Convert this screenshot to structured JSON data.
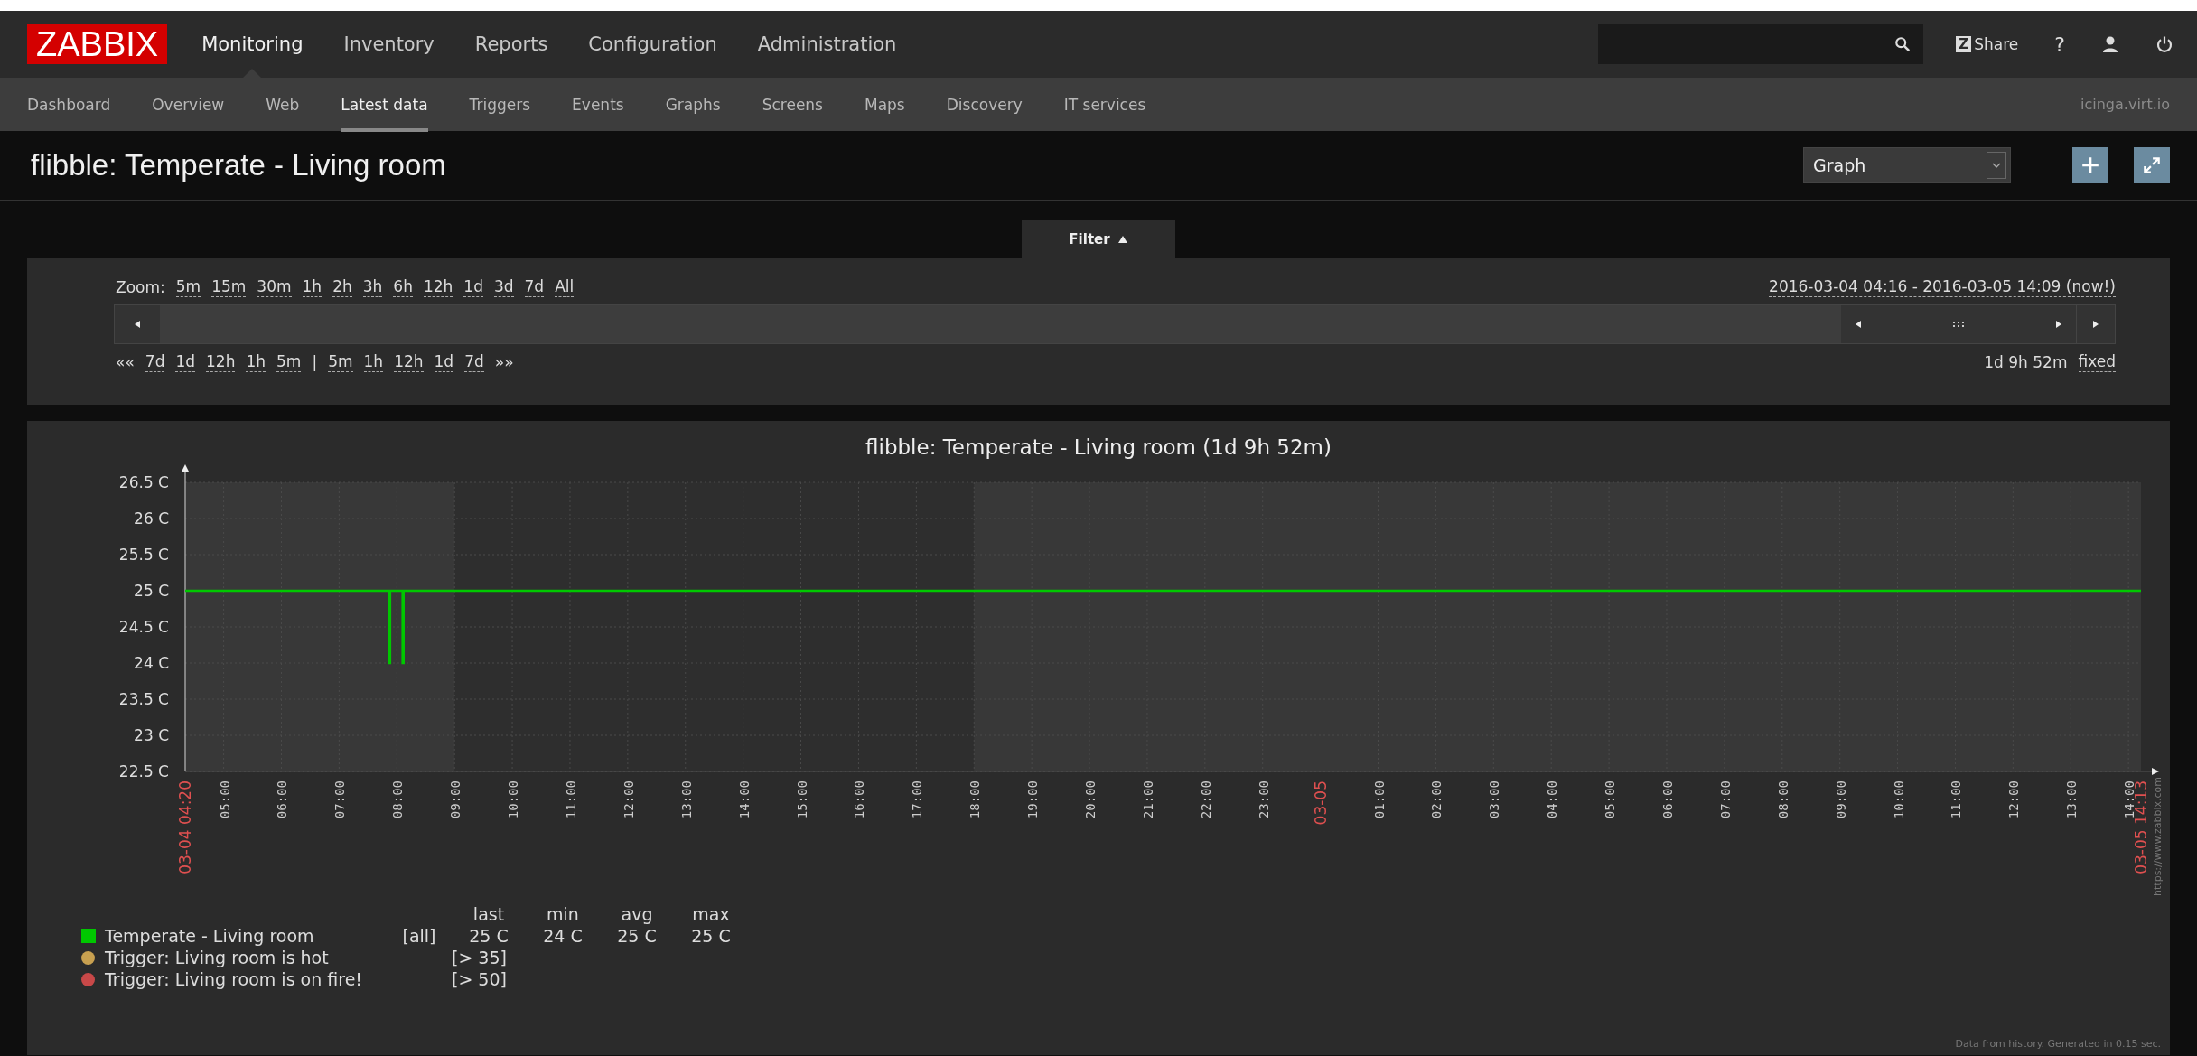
{
  "header": {
    "logo": "ZABBIX",
    "menu": [
      {
        "label": "Monitoring",
        "selected": true
      },
      {
        "label": "Inventory",
        "selected": false
      },
      {
        "label": "Reports",
        "selected": false
      },
      {
        "label": "Configuration",
        "selected": false
      },
      {
        "label": "Administration",
        "selected": false
      }
    ],
    "share_badge": "Z",
    "share": "Share",
    "help": "?"
  },
  "submenu": {
    "items": [
      {
        "label": "Dashboard",
        "selected": false
      },
      {
        "label": "Overview",
        "selected": false
      },
      {
        "label": "Web",
        "selected": false
      },
      {
        "label": "Latest data",
        "selected": true
      },
      {
        "label": "Triggers",
        "selected": false
      },
      {
        "label": "Events",
        "selected": false
      },
      {
        "label": "Graphs",
        "selected": false
      },
      {
        "label": "Screens",
        "selected": false
      },
      {
        "label": "Maps",
        "selected": false
      },
      {
        "label": "Discovery",
        "selected": false
      },
      {
        "label": "IT services",
        "selected": false
      }
    ],
    "server": "icinga.virt.io"
  },
  "page": {
    "title": "flibble: Temperate - Living room",
    "view_select": "Graph"
  },
  "filter": {
    "tab": "Filter",
    "expanded": true,
    "zoom_label": "Zoom:",
    "zoom_links": [
      "5m",
      "15m",
      "30m",
      "1h",
      "2h",
      "3h",
      "6h",
      "12h",
      "1d",
      "3d",
      "7d",
      "All"
    ],
    "range": "2016-03-04 04:16 - 2016-03-05 14:09 (now!)",
    "shift_links": [
      {
        "label": "««",
        "kind": "arrow"
      },
      {
        "label": "7d",
        "kind": "period"
      },
      {
        "label": "1d",
        "kind": "period"
      },
      {
        "label": "12h",
        "kind": "period"
      },
      {
        "label": "1h",
        "kind": "period"
      },
      {
        "label": "5m",
        "kind": "period"
      },
      {
        "label": "|",
        "kind": "separator"
      },
      {
        "label": "5m",
        "kind": "period"
      },
      {
        "label": "1h",
        "kind": "period"
      },
      {
        "label": "12h",
        "kind": "period"
      },
      {
        "label": "1d",
        "kind": "period"
      },
      {
        "label": "7d",
        "kind": "period"
      },
      {
        "label": "»»",
        "kind": "arrow"
      }
    ],
    "period": "1d 9h 52m",
    "fixed": "fixed"
  },
  "graph": {
    "title": "flibble: Temperate - Living room (1d 9h 52m)",
    "chart_data": {
      "type": "line",
      "grid": true,
      "ylim": [
        22.5,
        26.5
      ],
      "xlim": [
        "2016-03-04 04:20",
        "2016-03-05 14:13"
      ],
      "yticks": [
        {
          "value": 22.5,
          "label": "22.5 C"
        },
        {
          "value": 23,
          "label": "23 C"
        },
        {
          "value": 23.5,
          "label": "23.5 C"
        },
        {
          "value": 24,
          "label": "24 C"
        },
        {
          "value": 24.5,
          "label": "24.5 C"
        },
        {
          "value": 25,
          "label": "25 C"
        },
        {
          "value": 25.5,
          "label": "25.5 C"
        },
        {
          "value": 26,
          "label": "26 C"
        },
        {
          "value": 26.5,
          "label": "26.5 C"
        }
      ],
      "xticks": [
        {
          "value": "2016-03-04 04:20",
          "label": "03-04 04:20"
        },
        {
          "value": "2016-03-04 05:00",
          "label": "05:00"
        },
        {
          "value": "2016-03-04 06:00",
          "label": "06:00"
        },
        {
          "value": "2016-03-04 07:00",
          "label": "07:00"
        },
        {
          "value": "2016-03-04 08:00",
          "label": "08:00"
        },
        {
          "value": "2016-03-04 09:00",
          "label": "09:00"
        },
        {
          "value": "2016-03-04 10:00",
          "label": "10:00"
        },
        {
          "value": "2016-03-04 11:00",
          "label": "11:00"
        },
        {
          "value": "2016-03-04 12:00",
          "label": "12:00"
        },
        {
          "value": "2016-03-04 13:00",
          "label": "13:00"
        },
        {
          "value": "2016-03-04 14:00",
          "label": "14:00"
        },
        {
          "value": "2016-03-04 15:00",
          "label": "15:00"
        },
        {
          "value": "2016-03-04 16:00",
          "label": "16:00"
        },
        {
          "value": "2016-03-04 17:00",
          "label": "17:00"
        },
        {
          "value": "2016-03-04 18:00",
          "label": "18:00"
        },
        {
          "value": "2016-03-04 19:00",
          "label": "19:00"
        },
        {
          "value": "2016-03-04 20:00",
          "label": "20:00"
        },
        {
          "value": "2016-03-04 21:00",
          "label": "21:00"
        },
        {
          "value": "2016-03-04 22:00",
          "label": "22:00"
        },
        {
          "value": "2016-03-04 23:00",
          "label": "23:00"
        },
        {
          "value": "2016-03-05 00:00",
          "label": "03-05"
        },
        {
          "value": "2016-03-05 01:00",
          "label": "01:00"
        },
        {
          "value": "2016-03-05 02:00",
          "label": "02:00"
        },
        {
          "value": "2016-03-05 03:00",
          "label": "03:00"
        },
        {
          "value": "2016-03-05 04:00",
          "label": "04:00"
        },
        {
          "value": "2016-03-05 05:00",
          "label": "05:00"
        },
        {
          "value": "2016-03-05 06:00",
          "label": "06:00"
        },
        {
          "value": "2016-03-05 07:00",
          "label": "07:00"
        },
        {
          "value": "2016-03-05 08:00",
          "label": "08:00"
        },
        {
          "value": "2016-03-05 09:00",
          "label": "09:00"
        },
        {
          "value": "2016-03-05 10:00",
          "label": "10:00"
        },
        {
          "value": "2016-03-05 11:00",
          "label": "11:00"
        },
        {
          "value": "2016-03-05 12:00",
          "label": "12:00"
        },
        {
          "value": "2016-03-05 13:00",
          "label": "13:00"
        },
        {
          "value": "2016-03-05 14:00",
          "label": "14:00"
        },
        {
          "value": "2016-03-05 14:13",
          "label": "03-05 14:13"
        }
      ],
      "x": [
        "2016-03-04 04:20",
        "2016-03-04 07:52",
        "2016-03-04 07:52",
        "2016-03-04 07:53",
        "2016-03-04 07:53",
        "2016-03-04 08:06",
        "2016-03-04 08:06",
        "2016-03-04 08:07",
        "2016-03-04 08:07",
        "2016-03-05 14:13"
      ],
      "series": [
        {
          "name": "Temperate - Living room",
          "color": "#00c800",
          "values": [
            25,
            25,
            24,
            24,
            25,
            25,
            24,
            24,
            25,
            25
          ]
        }
      ]
    },
    "legend": {
      "headers": [
        "last",
        "min",
        "avg",
        "max"
      ],
      "items": [
        {
          "kind": "item",
          "function": "[all]",
          "last": "25 C",
          "min": "24 C",
          "avg": "25 C",
          "max": "25 C"
        },
        {
          "kind": "trigger",
          "name": "Trigger: Living room is hot",
          "color": "#c8a050",
          "condition": "[> 35]"
        },
        {
          "kind": "trigger",
          "name": "Trigger: Living room is on fire!",
          "color": "#c84848",
          "condition": "[> 50]"
        }
      ]
    },
    "url": "https://www.zabbix.com",
    "footer": "Data from history. Generated in 0.15 sec."
  }
}
